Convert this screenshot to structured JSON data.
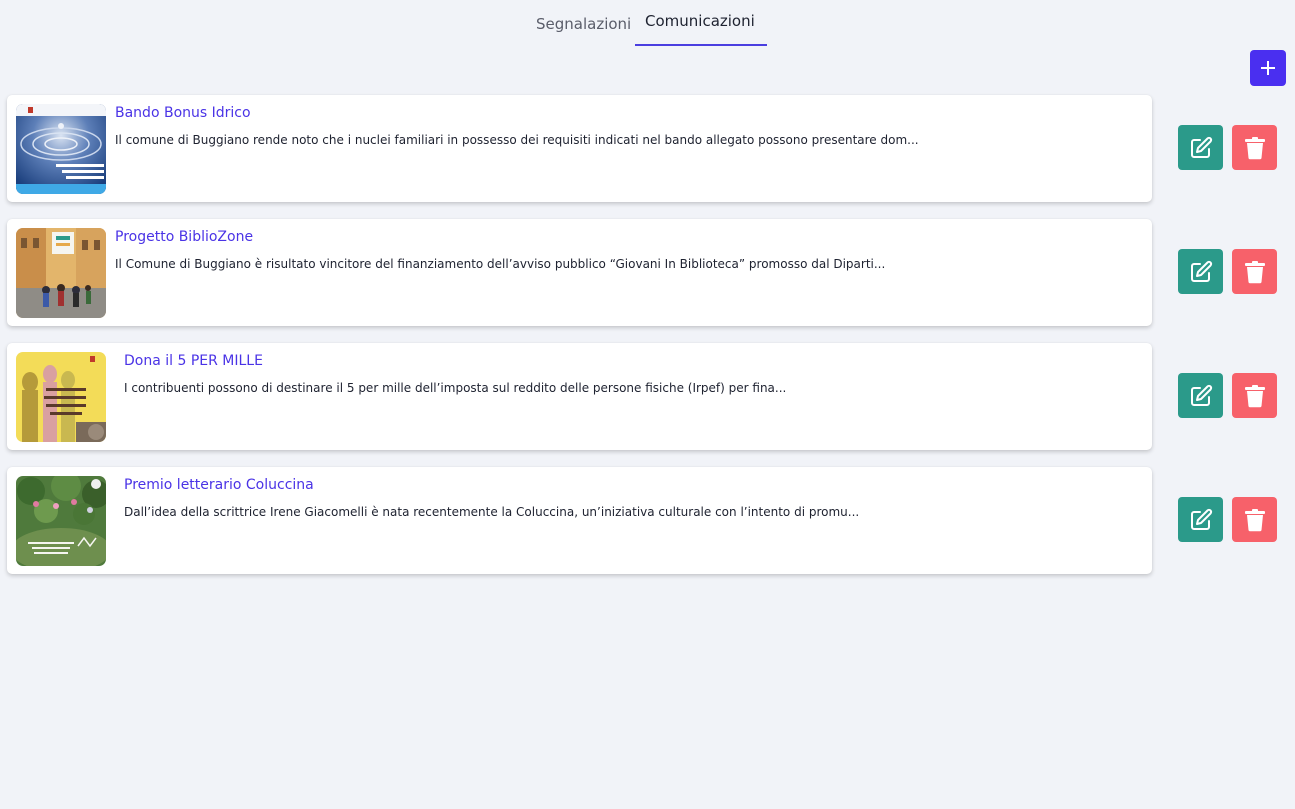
{
  "tabs": [
    {
      "label": "Segnalazioni"
    },
    {
      "label": "Comunicazioni"
    }
  ],
  "actions": {
    "add_icon": "plus-icon",
    "edit_icon": "edit-icon",
    "delete_icon": "trash-icon"
  },
  "items": [
    {
      "title": "Bando Bonus Idrico",
      "description": "Il comune di Buggiano rende noto che i nuclei familiari in possesso dei requisiti indicati nel bando allegato possono presentare dom..."
    },
    {
      "title": "Progetto BiblioZone",
      "description": "Il Comune di Buggiano è risultato vincitore del finanziamento dell’avviso pubblico “Giovani In Biblioteca” promosso dal Diparti..."
    },
    {
      "title": "Dona il 5 PER MILLE",
      "description": "I contribuenti possono di destinare il 5 per mille dell’imposta sul reddito delle persone fisiche (Irpef) per fina..."
    },
    {
      "title": "Premio letterario Coluccina",
      "description": "Dall’idea della scrittrice Irene Giacomelli è nata recentemente la Coluccina, un’iniziativa culturale con l’intento di promu..."
    }
  ],
  "colors": {
    "accent": "#4a2ff0",
    "title": "#4a33e6",
    "edit": "#2b9a8a",
    "delete": "#f7616a",
    "background": "#f1f3f8"
  }
}
